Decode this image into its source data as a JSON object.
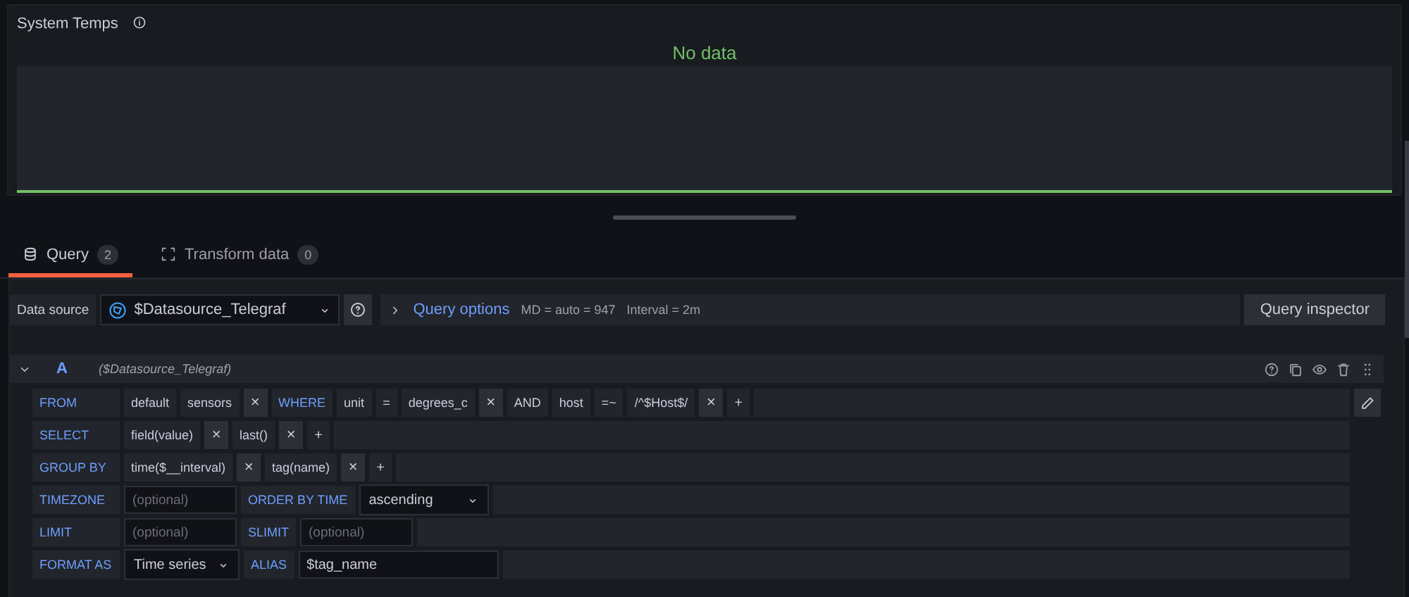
{
  "panel": {
    "title": "System Temps",
    "message": "No data"
  },
  "tabs": [
    {
      "label": "Query",
      "count": "2",
      "selected": true
    },
    {
      "label": "Transform data",
      "count": "0",
      "selected": false
    }
  ],
  "datasource": {
    "label": "Data source",
    "value": "$Datasource_Telegraf",
    "options_label": "Query options",
    "md": "MD = auto = 947",
    "interval": "Interval = 2m",
    "inspector": "Query inspector"
  },
  "query": {
    "ref": "A",
    "expanded": true,
    "datasource": "($Datasource_Telegraf)",
    "rows": [
      {
        "label": "FROM",
        "editable": true,
        "items": [
          {
            "kind": "segment",
            "text": "default"
          },
          {
            "kind": "segment",
            "text": "sensors"
          },
          {
            "kind": "remove",
            "text": "×"
          },
          {
            "kind": "keyword",
            "text": "WHERE"
          },
          {
            "kind": "segment",
            "text": "unit"
          },
          {
            "kind": "operator",
            "text": "="
          },
          {
            "kind": "segment",
            "text": "degrees_c"
          },
          {
            "kind": "remove",
            "text": "×"
          },
          {
            "kind": "segment",
            "text": "AND"
          },
          {
            "kind": "segment",
            "text": "host"
          },
          {
            "kind": "operator",
            "text": "=~"
          },
          {
            "kind": "segment",
            "text": "/^$Host$/"
          },
          {
            "kind": "remove",
            "text": "×"
          },
          {
            "kind": "add",
            "text": "+"
          }
        ]
      },
      {
        "label": "SELECT",
        "editable": false,
        "items": [
          {
            "kind": "segment",
            "text": "field(value)"
          },
          {
            "kind": "remove",
            "text": "×"
          },
          {
            "kind": "segment",
            "text": "last()"
          },
          {
            "kind": "remove",
            "text": "×"
          },
          {
            "kind": "add",
            "text": "+"
          }
        ]
      },
      {
        "label": "GROUP BY",
        "editable": false,
        "items": [
          {
            "kind": "segment",
            "text": "time($__interval)"
          },
          {
            "kind": "remove",
            "text": "×"
          },
          {
            "kind": "segment",
            "text": "tag(name)"
          },
          {
            "kind": "remove",
            "text": "×"
          },
          {
            "kind": "add",
            "text": "+"
          }
        ]
      },
      {
        "label": "TIMEZONE",
        "editable": false,
        "items": [
          {
            "kind": "input",
            "placeholder": "(optional)"
          },
          {
            "kind": "keyword",
            "text": "ORDER BY TIME"
          },
          {
            "kind": "select",
            "text": "ascending"
          }
        ]
      },
      {
        "label": "LIMIT",
        "editable": false,
        "items": [
          {
            "kind": "input",
            "placeholder": "(optional)"
          },
          {
            "kind": "keyword",
            "text": "SLIMIT"
          },
          {
            "kind": "input",
            "placeholder": "(optional)"
          }
        ]
      },
      {
        "label": "FORMAT AS",
        "editable": false,
        "items": [
          {
            "kind": "select",
            "text": "Time series"
          },
          {
            "kind": "keyword",
            "text": "ALIAS"
          },
          {
            "kind": "input",
            "value": "$tag_name"
          }
        ]
      }
    ]
  }
}
